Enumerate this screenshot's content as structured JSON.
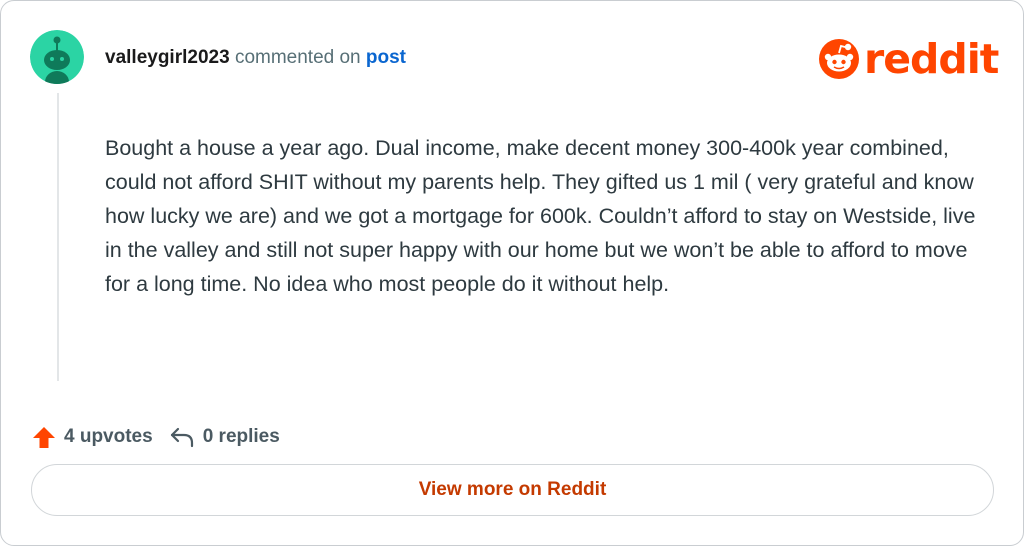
{
  "comment": {
    "username": "valleygirl2023",
    "commented_on_text": "commented on",
    "post_link_label": "post",
    "body": "Bought a house a year ago. Dual income, make decent money 300-400k year combined, could not afford SHIT without my parents help. They gifted us 1 mil ( very grateful and know how lucky we are) and we got a mortgage for 600k. Couldn’t afford to stay on Westside, live in the valley and still not super happy with our home but we won’t be able to afford to move for a long time. No idea who most people do it without help."
  },
  "brand": {
    "logo_text": "reddit",
    "accent_color": "#ff4500",
    "avatar_color": "#2bd4a4"
  },
  "stats": {
    "upvotes_label": "4 upvotes",
    "replies_label": "0 replies",
    "upvote_icon": "upvote-arrow-icon",
    "reply_icon": "reply-arrow-icon"
  },
  "footer": {
    "view_more_label": "View more on Reddit"
  }
}
